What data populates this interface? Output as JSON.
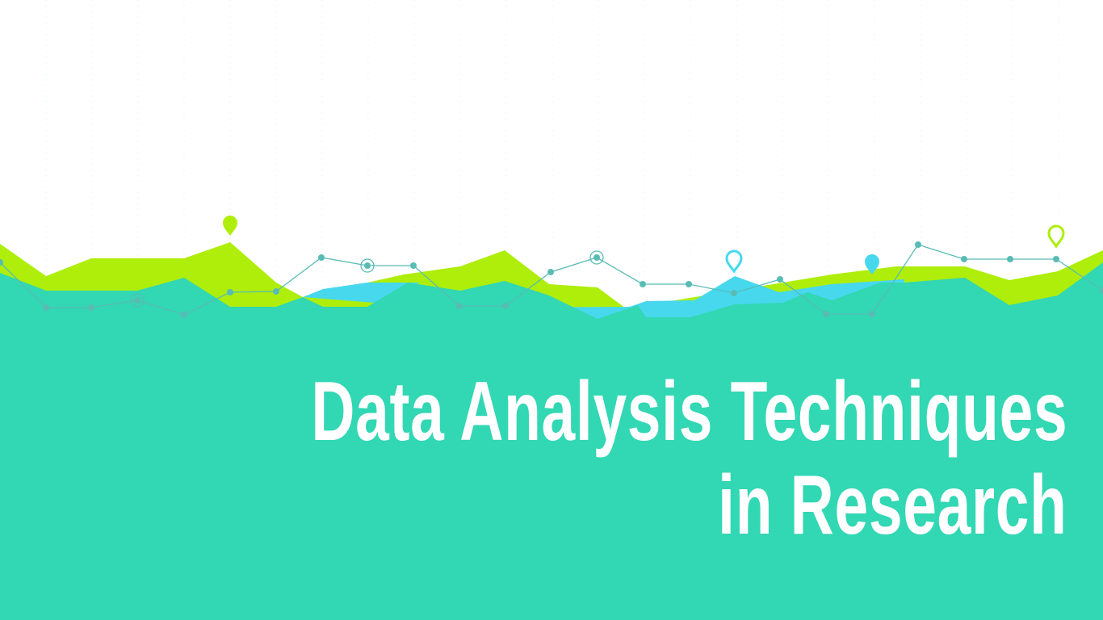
{
  "slide": {
    "title_line1": "Data Analysis Techniques",
    "title_line2": "in Research"
  },
  "colors": {
    "background": "#ffffff",
    "teal": "#32d7b3",
    "lime": "#aeee0a",
    "cyan": "#47d8ee",
    "line": "#58bcb4"
  },
  "decorative_icons": [
    "map-pin-filled-lime",
    "map-pin-outline-cyan",
    "map-pin-filled-cyan",
    "map-pin-outline-lime"
  ]
}
